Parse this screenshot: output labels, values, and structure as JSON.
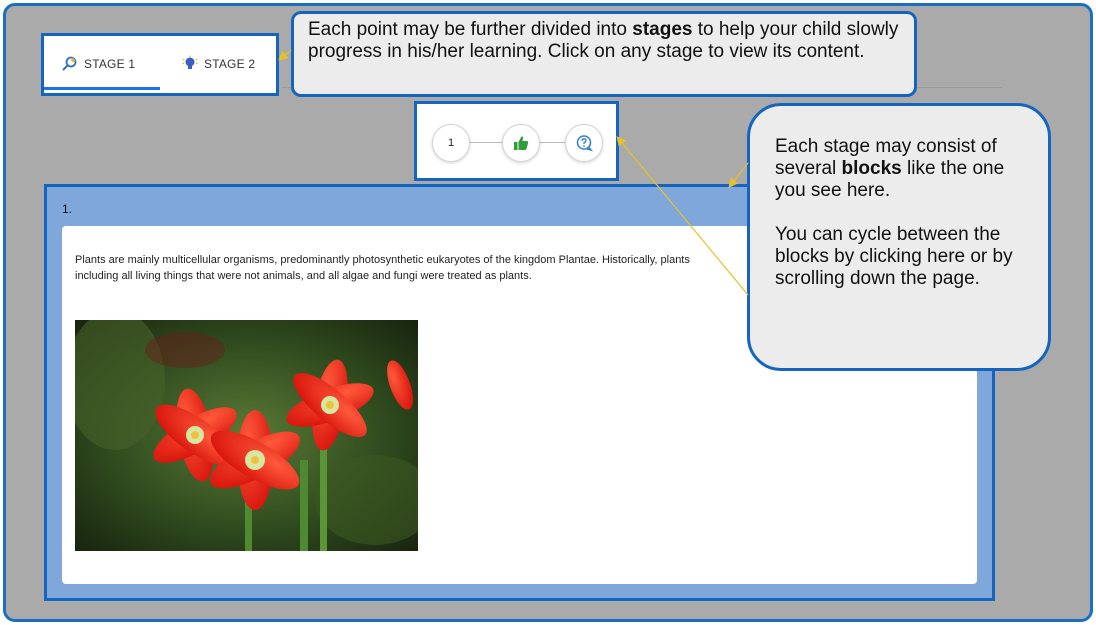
{
  "tabs": [
    {
      "label": "STAGE 1",
      "icon": "search-icon",
      "active": true
    },
    {
      "label": "STAGE 2",
      "icon": "lightbulb-icon",
      "active": false
    }
  ],
  "steps": [
    {
      "label": "1",
      "icon": null
    },
    {
      "label": "",
      "icon": "thumbs-up-icon"
    },
    {
      "label": "",
      "icon": "question-bubble-icon"
    }
  ],
  "block": {
    "title": "1.",
    "text_line1": "Plants are mainly multicellular organisms, predominantly photosynthetic eukaryotes of the kingdom Plantae. Historically, plants",
    "text_line2": "including all living things that were not animals, and all algae and fungi were treated as plants."
  },
  "callout_top": {
    "before": "Each point may be further divided into ",
    "bold": "stages",
    "after": " to help your child slowly progress in his/her learning. Click on any stage to view its content."
  },
  "callout_right": {
    "p1_before": "Each stage may consist of several ",
    "p1_bold": "blocks",
    "p1_after": " like the one you see here.",
    "p2": "You can cycle between the blocks by clicking here or by scrolling down the page."
  },
  "colors": {
    "accent": "#1565c0",
    "tab_underline": "#1a73e8",
    "block_header": "#7fa7d9",
    "thumbs_up": "#2e9e3a",
    "arrow": "#e6c229",
    "backdrop": "#aaaaaa"
  }
}
